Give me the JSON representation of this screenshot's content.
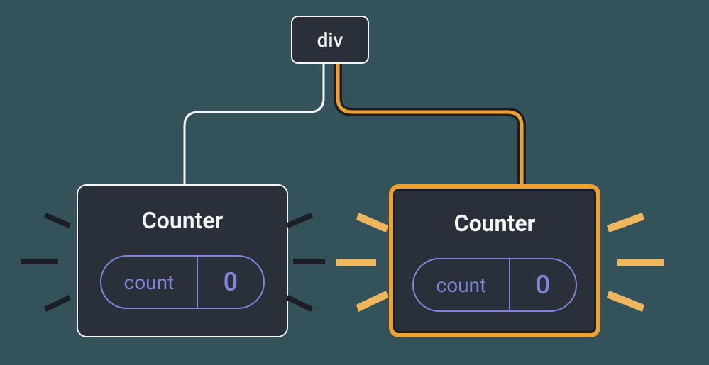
{
  "root": {
    "label": "div"
  },
  "left": {
    "title": "Counter",
    "state_key": "count",
    "state_value": "0",
    "highlighted": false,
    "colors": {
      "border": "#f5f5f5",
      "burst": "#1b1f25"
    }
  },
  "right": {
    "title": "Counter",
    "state_key": "count",
    "state_value": "0",
    "highlighted": true,
    "colors": {
      "border": "#eea12e",
      "burst": "#eeb75e"
    }
  },
  "palette": {
    "bg": "#33525a",
    "node_bg": "#2a3039",
    "text": "#f5f5f5",
    "accent": "#8184db",
    "highlight": "#eea12e"
  }
}
